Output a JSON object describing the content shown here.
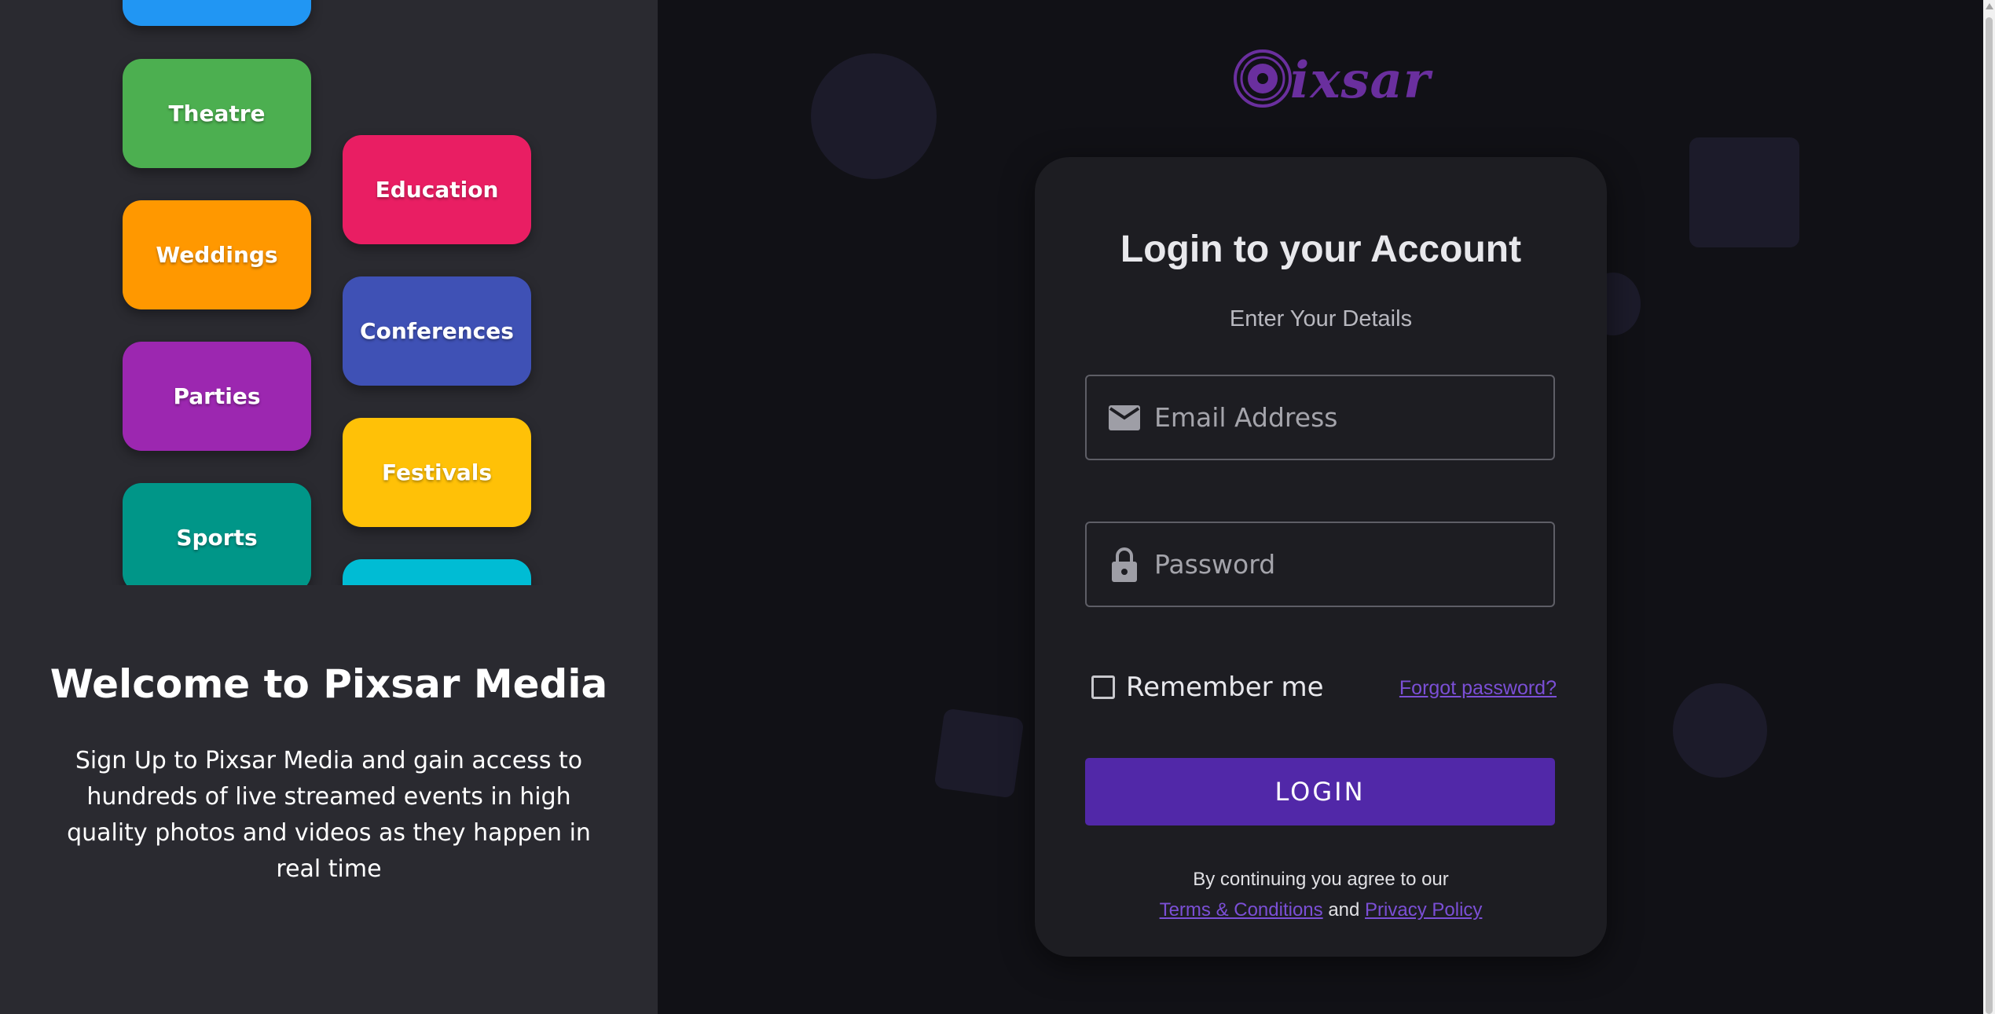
{
  "categories": {
    "col1": [
      "",
      "Theatre",
      "Weddings",
      "Parties",
      "Sports"
    ],
    "col2": [
      "Education",
      "Conferences",
      "Festivals",
      ""
    ],
    "colors": {
      "blue": "#2196f3",
      "green": "#4caf50",
      "orange": "#ff9800",
      "purple": "#9c27b0",
      "teal": "#009688",
      "pink": "#e91e63",
      "indigo": "#3f51b5",
      "amber": "#ffc107",
      "cyan": "#00bcd4"
    }
  },
  "left": {
    "welcome": "Welcome to Pixsar Media",
    "blurb": "Sign Up to Pixsar Media and gain access to hundreds of live streamed events in high quality photos and videos as they happen in real time"
  },
  "logo": {
    "text": "ixsar",
    "icon": "disc-logo-icon"
  },
  "login": {
    "title": "Login to your Account",
    "subtitle": "Enter Your Details",
    "email_placeholder": "Email Address",
    "password_placeholder": "Password",
    "remember_label": "Remember me",
    "forgot_label": "Forgot password?",
    "login_label": "LOGIN",
    "terms_prefix": "By continuing you agree to our",
    "terms_link": "Terms & Conditions",
    "and": "and",
    "privacy_link": "Privacy Policy"
  },
  "theme": {
    "accent": "#5128a8",
    "link": "#7b4fd6",
    "logo": "#6a2f9e"
  }
}
